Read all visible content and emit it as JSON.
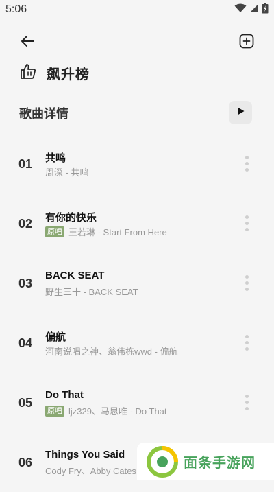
{
  "status_bar": {
    "time": "5:06",
    "icons": [
      "wifi-icon",
      "signal-icon",
      "battery-icon"
    ]
  },
  "header": {
    "back_icon": "arrow-left-icon",
    "add_icon": "add-square-icon",
    "title": "飙升榜",
    "title_icon": "thumbs-up-icon"
  },
  "section": {
    "title": "歌曲详情",
    "play_icon": "play-icon"
  },
  "songs": [
    {
      "rank": "01",
      "title": "共鸣",
      "badge": "",
      "subtitle": "周深 - 共鸣"
    },
    {
      "rank": "02",
      "title": "有你的快乐",
      "badge": "原唱",
      "subtitle": "王若琳 - Start From Here"
    },
    {
      "rank": "03",
      "title": "BACK SEAT",
      "badge": "",
      "subtitle": "野生三十 - BACK SEAT"
    },
    {
      "rank": "04",
      "title": "偏航",
      "badge": "",
      "subtitle": "河南说唱之神、翁伟栋wwd - 偏航"
    },
    {
      "rank": "05",
      "title": "Do That",
      "badge": "原唱",
      "subtitle": "ljz329、马思唯 - Do That"
    },
    {
      "rank": "06",
      "title": "Things You Said",
      "badge": "",
      "subtitle": "Cody Fry、Abby Cates"
    }
  ],
  "watermark": {
    "text": "面条手游网"
  },
  "colors": {
    "background": "#f5f5f5",
    "badge": "#8aa872",
    "watermark_green": "#48a35c"
  }
}
